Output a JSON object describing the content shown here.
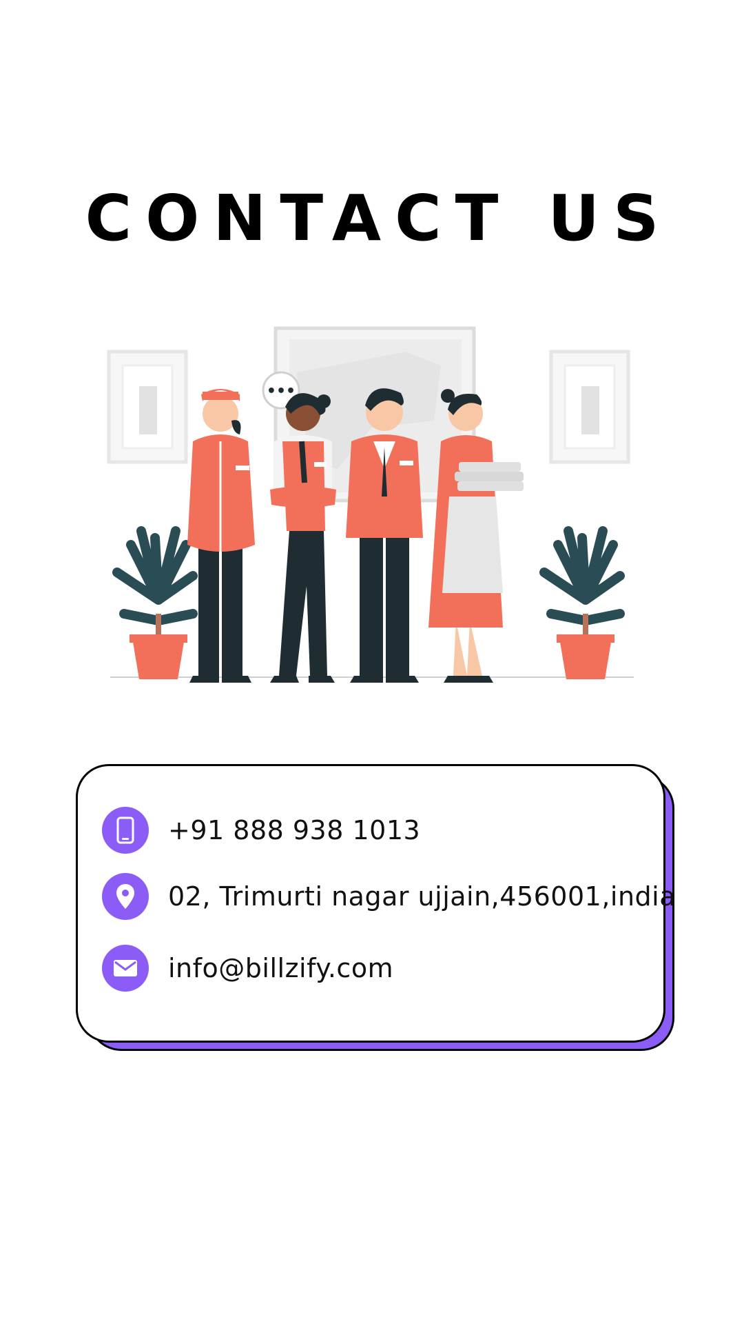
{
  "page": {
    "title": "CONTACT US"
  },
  "contact": {
    "phone": "+91 888 938 1013",
    "address": "02, Trimurti nagar ujjain,456001,india",
    "email": "info@billzify.com"
  },
  "icons": {
    "phone": "mobile-phone-icon",
    "address": "location-pin-icon",
    "email": "envelope-icon"
  },
  "colors": {
    "accent": "#8b5cf6",
    "uniform": "#f2705a",
    "dark": "#1f2d33",
    "text": "#111111"
  },
  "illustration": {
    "bubble_text": "•••"
  }
}
